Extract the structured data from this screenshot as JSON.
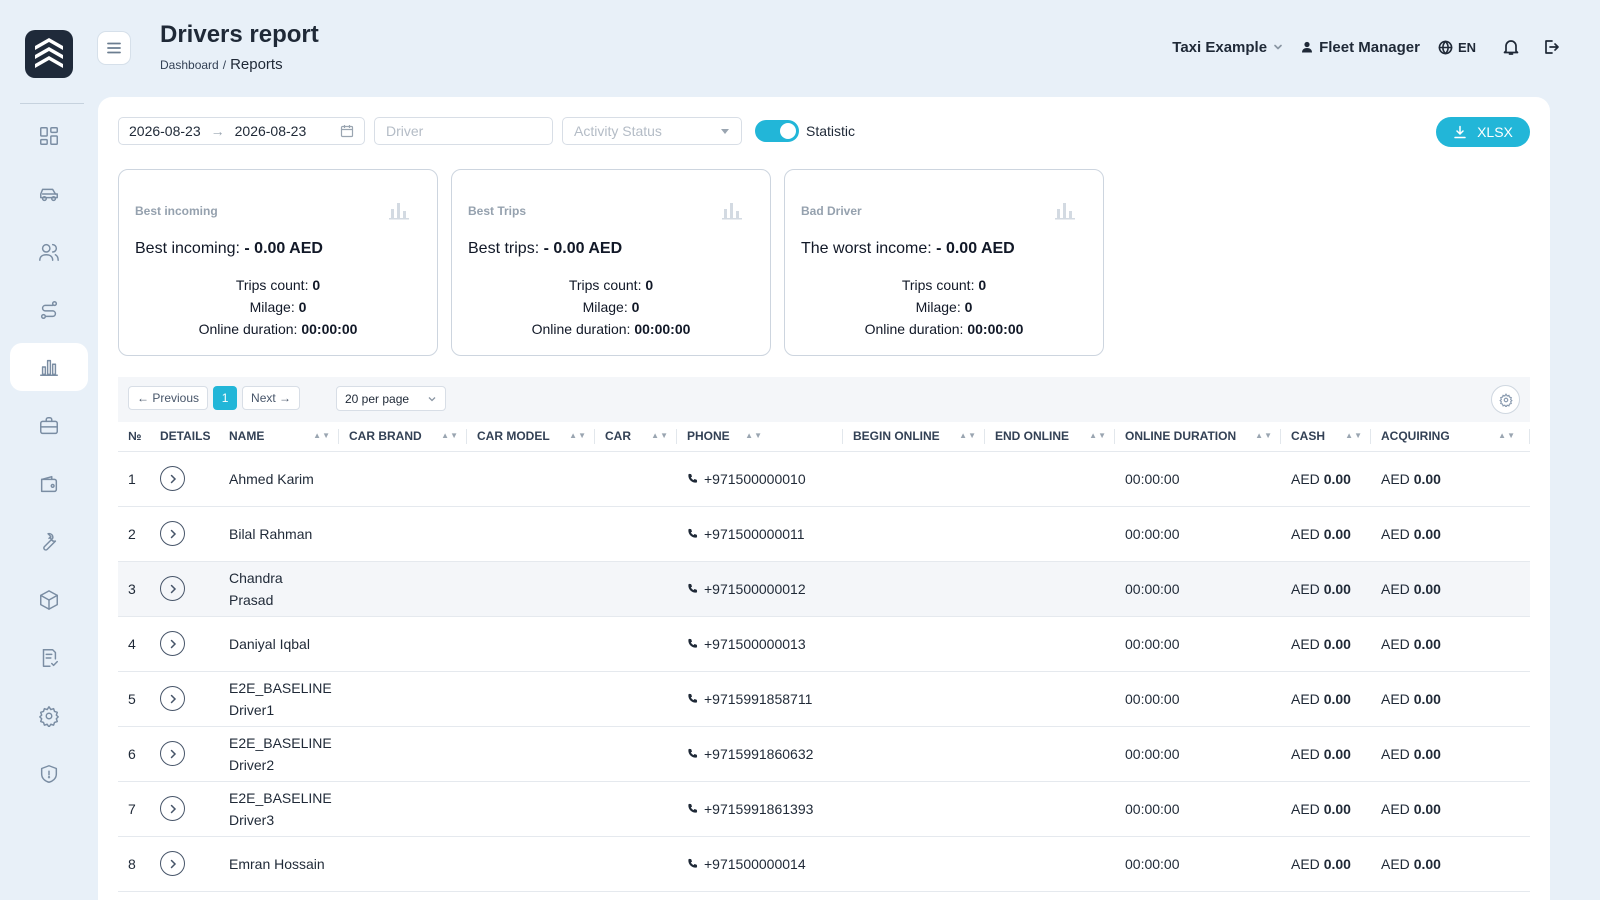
{
  "header": {
    "title": "Drivers report",
    "breadcrumb_root": "Dashboard",
    "breadcrumb_sep": "/",
    "breadcrumb_current": "Reports",
    "company": "Taxi Example",
    "user": "Fleet Manager",
    "language": "EN"
  },
  "sidebar": {
    "items": [
      {
        "icon": "dashboard-icon"
      },
      {
        "icon": "car-icon"
      },
      {
        "icon": "users-icon"
      },
      {
        "icon": "route-icon"
      },
      {
        "icon": "chart-icon",
        "active": true
      },
      {
        "icon": "briefcase-icon"
      },
      {
        "icon": "wallet-icon"
      },
      {
        "icon": "wrench-icon"
      },
      {
        "icon": "box-icon"
      },
      {
        "icon": "checklist-icon"
      },
      {
        "icon": "gear-icon"
      },
      {
        "icon": "shield-icon"
      }
    ]
  },
  "filters": {
    "date_from": "2026-08-23",
    "date_to": "2026-08-23",
    "driver_placeholder": "Driver",
    "status_placeholder": "Activity Status",
    "statistic_label": "Statistic",
    "statistic_on": true,
    "export_label": "XLSX"
  },
  "stats": [
    {
      "title": "Best incoming",
      "label": "Best incoming:",
      "value": "- 0.00 AED",
      "trips_label": "Trips count:",
      "trips": "0",
      "milage_label": "Milage:",
      "milage": "0",
      "duration_label": "Online duration:",
      "duration": "00:00:00"
    },
    {
      "title": "Best Trips",
      "label": "Best trips:",
      "value": "- 0.00 AED",
      "trips_label": "Trips count:",
      "trips": "0",
      "milage_label": "Milage:",
      "milage": "0",
      "duration_label": "Online duration:",
      "duration": "00:00:00"
    },
    {
      "title": "Bad Driver",
      "label": "The worst income:",
      "value": "- 0.00 AED",
      "trips_label": "Trips count:",
      "trips": "0",
      "milage_label": "Milage:",
      "milage": "0",
      "duration_label": "Online duration:",
      "duration": "00:00:00"
    }
  ],
  "pagination": {
    "prev_label": "← Previous",
    "current_page": "1",
    "next_label": "Next →",
    "per_page": "20 per page"
  },
  "table": {
    "columns": [
      "№",
      "DETAILS",
      "NAME",
      "CAR BRAND",
      "CAR MODEL",
      "CAR",
      "PHONE",
      "BEGIN ONLINE",
      "END ONLINE",
      "ONLINE DURATION",
      "CASH",
      "ACQUIRING"
    ],
    "currency": "AED",
    "rows": [
      {
        "num": "1",
        "name": "Ahmed Karim",
        "name2": "",
        "phone": "+971500000010",
        "duration": "00:00:00",
        "cash": "0.00",
        "acquiring": "0.00"
      },
      {
        "num": "2",
        "name": "Bilal Rahman",
        "name2": "",
        "phone": "+971500000011",
        "duration": "00:00:00",
        "cash": "0.00",
        "acquiring": "0.00"
      },
      {
        "num": "3",
        "name": "Chandra Prasad",
        "name2": "",
        "phone": "+971500000012",
        "duration": "00:00:00",
        "cash": "0.00",
        "acquiring": "0.00"
      },
      {
        "num": "4",
        "name": "Daniyal Iqbal",
        "name2": "",
        "phone": "+971500000013",
        "duration": "00:00:00",
        "cash": "0.00",
        "acquiring": "0.00"
      },
      {
        "num": "5",
        "name": "E2E_BASELINE",
        "name2": "Driver1",
        "phone": "+9715991858711",
        "duration": "00:00:00",
        "cash": "0.00",
        "acquiring": "0.00"
      },
      {
        "num": "6",
        "name": "E2E_BASELINE",
        "name2": "Driver2",
        "phone": "+9715991860632",
        "duration": "00:00:00",
        "cash": "0.00",
        "acquiring": "0.00"
      },
      {
        "num": "7",
        "name": "E2E_BASELINE",
        "name2": "Driver3",
        "phone": "+9715991861393",
        "duration": "00:00:00",
        "cash": "0.00",
        "acquiring": "0.00"
      },
      {
        "num": "8",
        "name": "Emran Hossain",
        "name2": "",
        "phone": "+971500000014",
        "duration": "00:00:00",
        "cash": "0.00",
        "acquiring": "0.00"
      }
    ]
  }
}
